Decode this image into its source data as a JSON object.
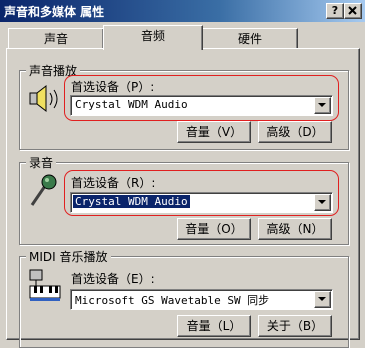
{
  "window": {
    "title": "声音和多媒体 属性"
  },
  "tabs": [
    {
      "label": "声音"
    },
    {
      "label": "音频"
    },
    {
      "label": "硬件"
    }
  ],
  "playback": {
    "legend": "声音播放",
    "device_label": "首选设备（P）:",
    "device_value": "Crystal WDM Audio",
    "volume_button": "音量（V）",
    "advanced_button": "高级（D）"
  },
  "recording": {
    "legend": "录音",
    "device_label": "首选设备（R）:",
    "device_value": "Crystal WDM Audio",
    "volume_button": "音量（O）",
    "advanced_button": "高级（N）"
  },
  "midi": {
    "legend": "MIDI 音乐播放",
    "device_label": "首选设备（E）:",
    "device_value": "Microsoft GS Wavetable SW 同步",
    "volume_button": "音量（L）",
    "about_button": "关于（B）"
  }
}
